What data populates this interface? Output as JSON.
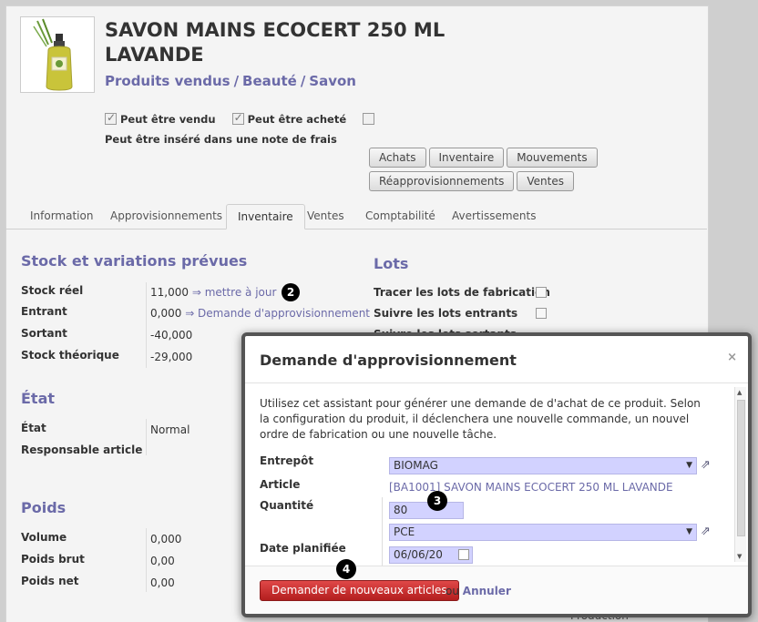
{
  "product": {
    "title": "SAVON MAINS ECOCERT 250 ML LAVANDE",
    "breadcrumb": [
      "Produits vendus",
      "Beauté",
      "Savon"
    ],
    "checks": {
      "peut_etre_vendu": "Peut être vendu",
      "peut_etre_achete": "Peut être acheté",
      "note_de_frais": "Peut être inséré dans une note de frais"
    }
  },
  "buttons": [
    "Achats",
    "Inventaire",
    "Mouvements",
    "Réapprovisionnements",
    "Ventes"
  ],
  "tabs": [
    "Information",
    "Approvisionnements",
    "Inventaire",
    "Ventes",
    "Comptabilité",
    "Avertissements"
  ],
  "stock": {
    "title": "Stock et variations prévues",
    "stock_reel_label": "Stock réel",
    "stock_reel_value": "11,000",
    "mettre_a_jour": "⇒ mettre à jour",
    "entrant_label": "Entrant",
    "entrant_value": "0,000",
    "demande_link": "⇒ Demande d'approvisionnement",
    "sortant_label": "Sortant",
    "sortant_value": "-40,000",
    "theorique_label": "Stock théorique",
    "theorique_value": "-29,000"
  },
  "lots": {
    "title": "Lots",
    "tracer_fab": "Tracer les lots de fabrication",
    "suivre_entrants": "Suivre les lots entrants",
    "suivre_sortants": "Suivre les lots sortants"
  },
  "etat": {
    "title": "État",
    "etat_label": "État",
    "etat_value": "Normal",
    "responsable_label": "Responsable article"
  },
  "poids": {
    "title": "Poids",
    "volume_label": "Volume",
    "volume_value": "0,000",
    "brut_label": "Poids brut",
    "brut_value": "0,00",
    "net_label": "Poids net",
    "net_value": "0,00"
  },
  "production_label": "Production",
  "badges": {
    "b2": "2",
    "b3": "3",
    "b4": "4"
  },
  "modal": {
    "title": "Demande d'approvisionnement",
    "close": "×",
    "intro": "Utilisez cet assistant pour générer une demande de d'achat de ce produit. Selon la configuration du produit, il déclenchera une nouvelle commande, un nouvel ordre de fabrication ou une nouvelle tâche.",
    "entrepot_label": "Entrepôt",
    "entrepot_value": "BIOMAG",
    "article_label": "Article",
    "article_value": "[BA1001] SAVON MAINS ECOCERT 250 ML LAVANDE",
    "quantite_label": "Quantité",
    "quantite_value": "80",
    "unit_value": "PCE",
    "date_label": "Date planifiée",
    "date_value": "06/06/20",
    "submit": "Demander de nouveaux articles",
    "or": "ou",
    "cancel": "Annuler"
  }
}
